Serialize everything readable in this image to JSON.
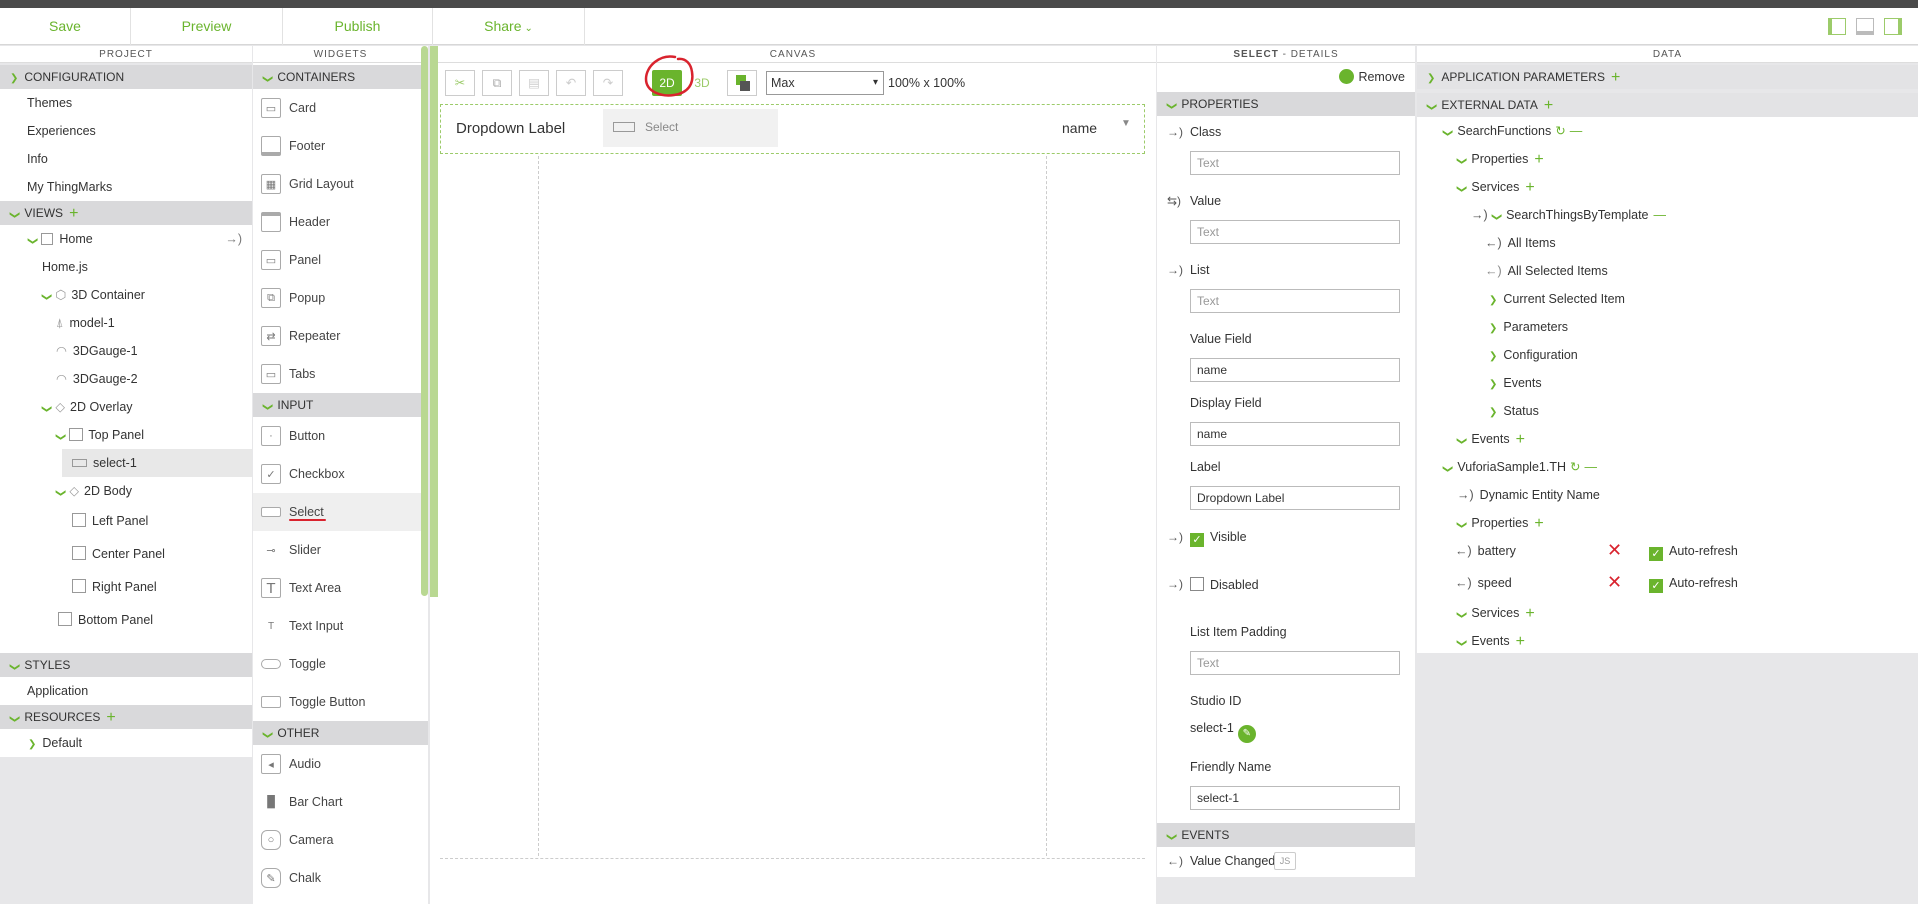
{
  "toolbar": {
    "save": "Save",
    "preview": "Preview",
    "publish": "Publish",
    "share": "Share",
    "share_caret": "⌄"
  },
  "project": {
    "header": "PROJECT",
    "configuration": "CONFIGURATION",
    "config_items": [
      "Themes",
      "Experiences",
      "Info",
      "My ThingMarks"
    ],
    "views": "VIEWS",
    "home": "Home",
    "homejs": "Home.js",
    "container3d": "3D Container",
    "model1": "model-1",
    "gauge1": "3DGauge-1",
    "gauge2": "3DGauge-2",
    "overlay2d": "2D Overlay",
    "toppanel": "Top Panel",
    "select1": "select-1",
    "body2d": "2D Body",
    "leftpanel": "Left Panel",
    "centerpanel": "Center Panel",
    "rightpanel": "Right Panel",
    "bottompanel": "Bottom Panel",
    "styles": "STYLES",
    "application": "Application",
    "resources": "RESOURCES",
    "default": "Default"
  },
  "widgets": {
    "header": "WIDGETS",
    "containers": "CONTAINERS",
    "container_items": [
      "Card",
      "Footer",
      "Grid Layout",
      "Header",
      "Panel",
      "Popup",
      "Repeater",
      "Tabs"
    ],
    "input": "INPUT",
    "input_items": [
      "Button",
      "Checkbox",
      "Select",
      "Slider",
      "Text Area",
      "Text Input",
      "Toggle",
      "Toggle Button"
    ],
    "other": "OTHER",
    "other_items": [
      "Audio",
      "Bar Chart",
      "Camera",
      "Chalk"
    ]
  },
  "canvas": {
    "header": "CANVAS",
    "mode2d": "2D",
    "mode3d": "3D",
    "size_select": "Max",
    "size_options": [
      "Max"
    ],
    "dimensions": "100% x 100%",
    "dropdown_label": "Dropdown Label",
    "select_placeholder": "Select",
    "select_value": "name"
  },
  "details": {
    "header_bold": "SELECT",
    "header_rest": " - DETAILS",
    "remove": "Remove",
    "properties": "PROPERTIES",
    "class_label": "Class",
    "class_ph": "Text",
    "value_label": "Value",
    "value_ph": "Text",
    "list_label": "List",
    "list_ph": "Text",
    "valuefield_label": "Value Field",
    "valuefield_val": "name",
    "displayfield_label": "Display Field",
    "displayfield_val": "name",
    "label_label": "Label",
    "label_val": "Dropdown Label",
    "visible_label": "Visible",
    "disabled_label": "Disabled",
    "padding_label": "List Item Padding",
    "padding_ph": "Text",
    "studioid_label": "Studio ID",
    "studioid_val": "select-1",
    "friendly_label": "Friendly Name",
    "friendly_val": "select-1",
    "events": "EVENTS",
    "value_changed": "Value Changed",
    "js_badge": "JS"
  },
  "data": {
    "header": "DATA",
    "app_params": "APPLICATION PARAMETERS",
    "external": "EXTERNAL DATA",
    "searchfunctions": "SearchFunctions",
    "properties": "Properties",
    "services": "Services",
    "searchthings": "SearchThingsByTemplate",
    "allitems": "All Items",
    "allselected": "All Selected Items",
    "currentselected": "Current Selected Item",
    "parameters": "Parameters",
    "configuration": "Configuration",
    "events": "Events",
    "status": "Status",
    "vuforia": "VuforiaSample1.TH",
    "dynamic": "Dynamic Entity Name",
    "battery": "battery",
    "speed": "speed",
    "autorefresh": "Auto-refresh"
  },
  "colors": {
    "accent": "#6ab42d",
    "annotation_red": "#d9232e"
  }
}
